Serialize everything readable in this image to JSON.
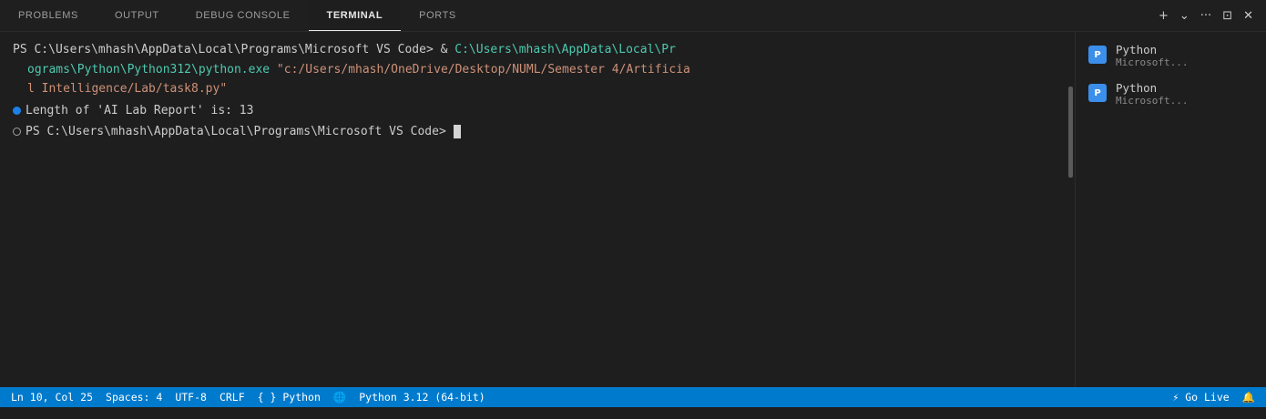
{
  "tabs": [
    {
      "label": "PROBLEMS"
    },
    {
      "label": "OUTPUT"
    },
    {
      "label": "DEBUG CONSOLE"
    },
    {
      "label": "TERMINAL",
      "active": true
    },
    {
      "label": "PORTS"
    }
  ],
  "tab_actions": {
    "new_terminal": "+",
    "dropdown": "⌄",
    "more": "···",
    "maximize": "⊡",
    "close": "✕"
  },
  "terminal": {
    "prompt": "PS C:\\Users\\mhash\\AppData\\Local\\Programs\\Microsoft VS Code> & ",
    "cmd_part1": "C:\\Users\\mhash\\AppData\\Local\\Pr",
    "cmd_part2": "ograms\\Python\\Python312\\python.exe",
    "arg_part1": " \"c:/Users/mhash/OneDrive/Desktop/NUML/Semester 4/Artificia",
    "arg_part2": "l Intelligence/Lab/task8.py\"",
    "output": "Length of 'AI Lab Report' is: 13",
    "prompt2": "PS C:\\Users\\mhash\\AppData\\Local\\Programs\\Microsoft VS Code>"
  },
  "side_panel": {
    "items": [
      {
        "icon": "python-icon",
        "name": "Python",
        "sub": "Microsoft..."
      },
      {
        "icon": "python-icon",
        "name": "Python",
        "sub": "Microsoft..."
      }
    ]
  },
  "statusbar": {
    "position": "Ln 10, Col 25",
    "spaces": "Spaces: 4",
    "encoding": "UTF-8",
    "eol": "CRLF",
    "language": "{ } Python",
    "globe": "🌐",
    "interpreter": "Python 3.12 (64-bit)",
    "go_live": "⚡ Go Live",
    "bell": "🔔"
  },
  "colors": {
    "accent": "#007acc",
    "path_cyan": "#4ec9b0",
    "string_orange": "#ce9178",
    "success_dot": "#1b81e6"
  }
}
